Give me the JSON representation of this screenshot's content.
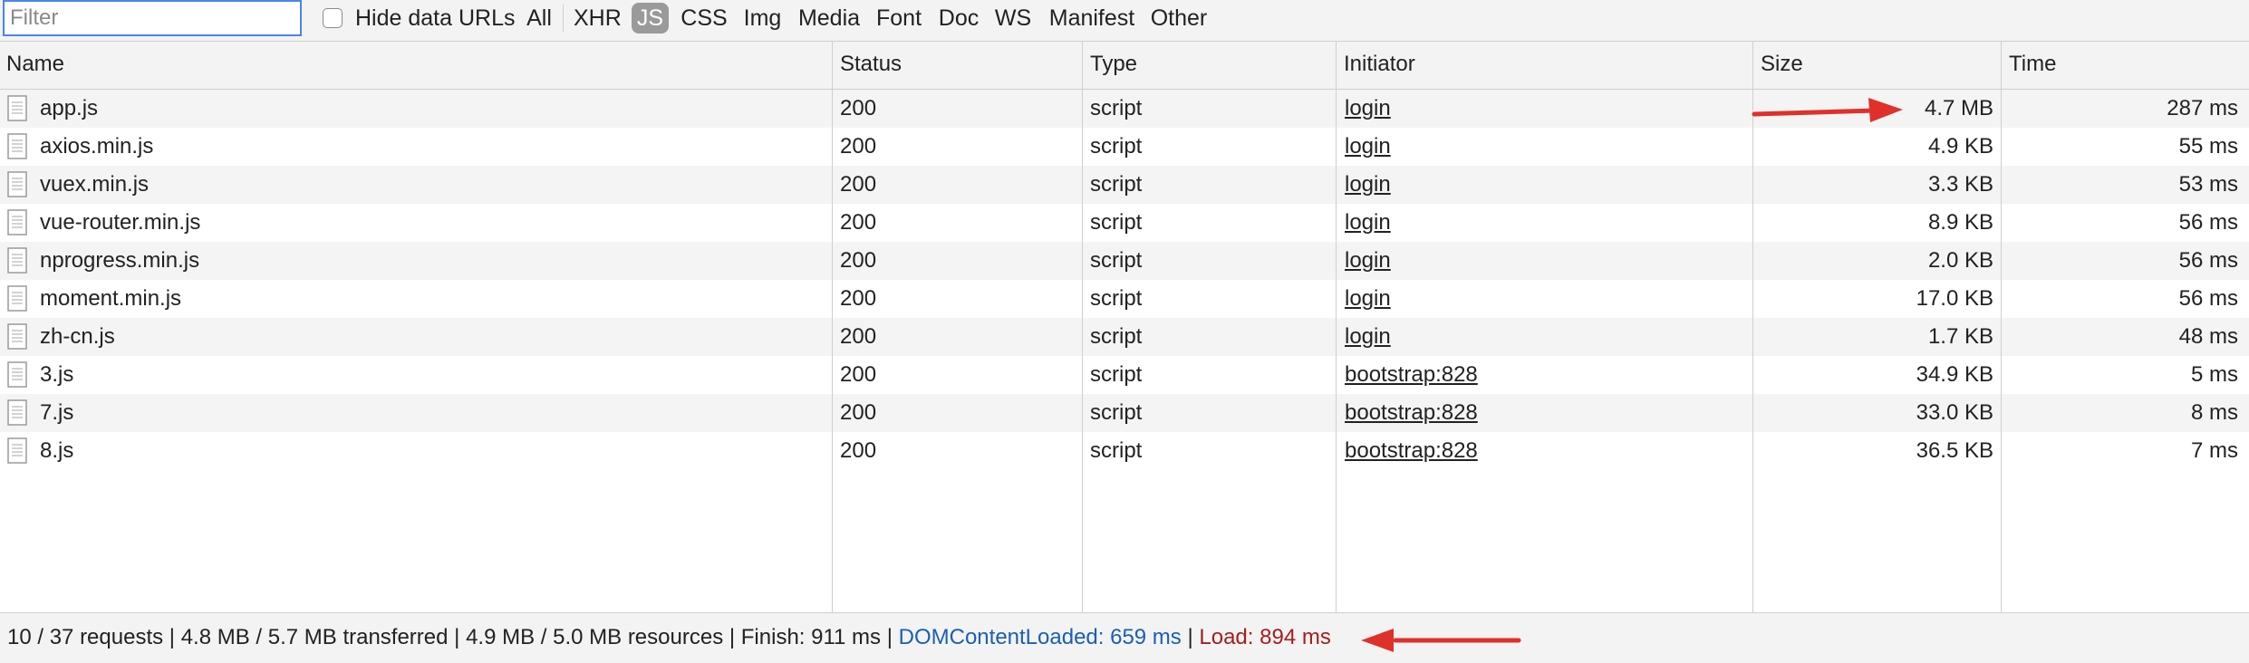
{
  "toolbar": {
    "filter_placeholder": "Filter",
    "filter_value": "",
    "hide_data_urls_label": "Hide data URLs",
    "hide_data_urls_checked": false,
    "types": [
      "All",
      "XHR",
      "JS",
      "CSS",
      "Img",
      "Media",
      "Font",
      "Doc",
      "WS",
      "Manifest",
      "Other"
    ],
    "active_type": "JS",
    "active_color": "#9a9a9a"
  },
  "table": {
    "columns": [
      "Name",
      "Status",
      "Type",
      "Initiator",
      "Size",
      "Time"
    ],
    "rows": [
      {
        "name": "app.js",
        "status": "200",
        "type": "script",
        "initiator": "login",
        "size": "4.7 MB",
        "time": "287 ms"
      },
      {
        "name": "axios.min.js",
        "status": "200",
        "type": "script",
        "initiator": "login",
        "size": "4.9 KB",
        "time": "55 ms"
      },
      {
        "name": "vuex.min.js",
        "status": "200",
        "type": "script",
        "initiator": "login",
        "size": "3.3 KB",
        "time": "53 ms"
      },
      {
        "name": "vue-router.min.js",
        "status": "200",
        "type": "script",
        "initiator": "login",
        "size": "8.9 KB",
        "time": "56 ms"
      },
      {
        "name": "nprogress.min.js",
        "status": "200",
        "type": "script",
        "initiator": "login",
        "size": "2.0 KB",
        "time": "56 ms"
      },
      {
        "name": "moment.min.js",
        "status": "200",
        "type": "script",
        "initiator": "login",
        "size": "17.0 KB",
        "time": "56 ms"
      },
      {
        "name": "zh-cn.js",
        "status": "200",
        "type": "script",
        "initiator": "login",
        "size": "1.7 KB",
        "time": "48 ms"
      },
      {
        "name": "3.js",
        "status": "200",
        "type": "script",
        "initiator": "bootstrap:828",
        "size": "34.9 KB",
        "time": "5 ms"
      },
      {
        "name": "7.js",
        "status": "200",
        "type": "script",
        "initiator": "bootstrap:828",
        "size": "33.0 KB",
        "time": "8 ms"
      },
      {
        "name": "8.js",
        "status": "200",
        "type": "script",
        "initiator": "bootstrap:828",
        "size": "36.5 KB",
        "time": "7 ms"
      }
    ],
    "row_icon": "file-document-icon"
  },
  "statusbar": {
    "requests": "10 / 37 requests",
    "transferred": "4.8 MB / 5.7 MB transferred",
    "resources": "4.9 MB / 5.0 MB resources",
    "finish": "Finish: 911 ms",
    "dom_content_loaded": "DOMContentLoaded: 659 ms",
    "load": "Load: 894 ms",
    "separator": "|",
    "dom_color": "#1a5fb4",
    "load_color": "#a51d1d"
  },
  "annotations": {
    "arrow_color": "#e0302a",
    "arrows": [
      "annotation-arrow-size",
      "annotation-arrow-load"
    ]
  }
}
